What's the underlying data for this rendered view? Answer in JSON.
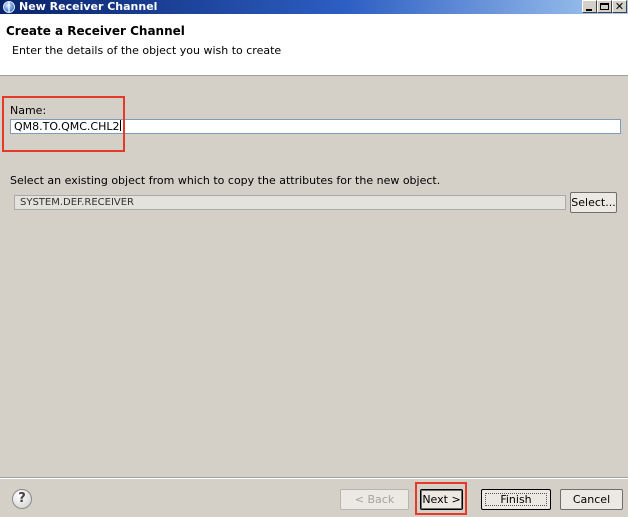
{
  "window": {
    "title": "New Receiver Channel",
    "minimize_glyph": "",
    "maximize_glyph": "",
    "close_glyph": "✕"
  },
  "banner": {
    "title": "Create a Receiver Channel",
    "description": "Enter the details of the object you wish to create"
  },
  "name_field": {
    "label": "Name:",
    "value": "QM8.TO.QMC.CHL2"
  },
  "copy_object": {
    "label": "Select an existing object from which to copy the attributes for the new object.",
    "value": "SYSTEM.DEF.RECEIVER",
    "select_label": "Select..."
  },
  "footer": {
    "help_glyph": "?",
    "back_label": "< Back",
    "next_label": "Next >",
    "finish_label": "Finish",
    "cancel_label": "Cancel"
  },
  "colors": {
    "highlight": "#e53a2a",
    "title_bar_start": "#0a246a",
    "title_bar_end": "#a6caf0",
    "dialog_bg": "#d4d0c8"
  },
  "icons": {
    "window_icon": "globe-icon",
    "help_icon": "help-icon"
  }
}
